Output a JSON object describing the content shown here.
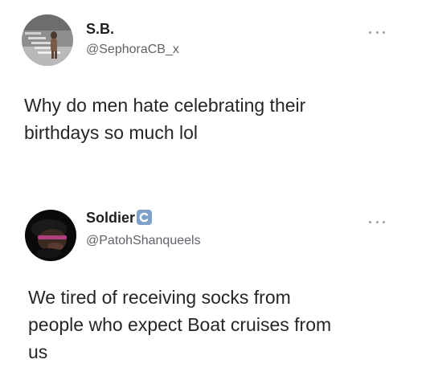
{
  "tweets": [
    {
      "name": "S.B.",
      "handle": "@SephoraCB_x",
      "verified": false,
      "lines": [
        "Why do men hate celebrating their",
        "birthdays so much lol"
      ]
    },
    {
      "name": "Soldier",
      "handle": "@PatohShanqueels",
      "verified": true,
      "lines": [
        "We tired of receiving socks from",
        "people who expect Boat cruises from",
        "us"
      ]
    }
  ],
  "icons": {
    "more": "more-options-icon",
    "verified": "verified-badge-icon"
  },
  "colors": {
    "name": "#1f1f1f",
    "handle": "#5f6368",
    "text": "#262626",
    "badge": "#7fa0c8"
  }
}
